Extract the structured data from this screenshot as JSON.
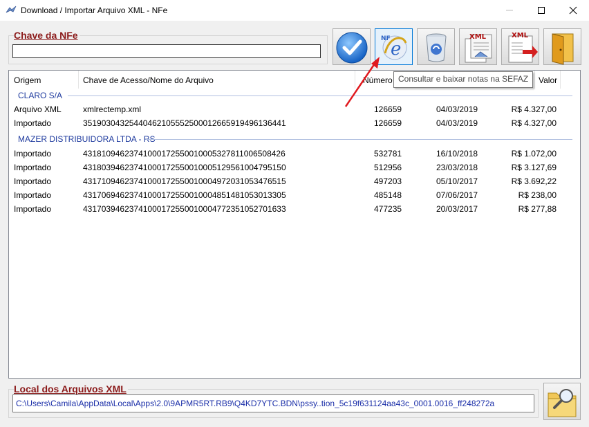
{
  "window": {
    "title": "Download / Importar Arquivo XML - NFe",
    "minimize": "—",
    "maximize": "☐",
    "close": "✕"
  },
  "chave_group": {
    "label": "Chave da NFe",
    "value": ""
  },
  "toolbar": {
    "buttons": [
      {
        "name": "confirm-button",
        "icon": "check-icon"
      },
      {
        "name": "sefaz-button",
        "icon": "nfe-e-icon"
      },
      {
        "name": "delete-button",
        "icon": "recycle-bin-icon"
      },
      {
        "name": "xml-list-button",
        "icon": "xml-document-icon"
      },
      {
        "name": "xml-import-button",
        "icon": "xml-arrow-icon"
      },
      {
        "name": "exit-button",
        "icon": "door-exit-icon"
      }
    ]
  },
  "tooltip": {
    "text": "Consultar e baixar notas na SEFAZ"
  },
  "list": {
    "columns": [
      "Origem",
      "Chave de Acesso/Nome do Arquivo",
      "Número",
      "Valor"
    ],
    "groups": [
      {
        "name": "CLARO S/A",
        "rows": [
          {
            "origem": "Arquivo XML",
            "chave": "xmlrectemp.xml",
            "numero": "126659",
            "data": "04/03/2019",
            "valor": "R$ 4.327,00"
          },
          {
            "origem": "Importado",
            "chave": "35190304325440462105552500012665919496136441",
            "numero": "126659",
            "data": "04/03/2019",
            "valor": "R$ 4.327,00"
          }
        ]
      },
      {
        "name": "MAZER DISTRIBUIDORA LTDA - RS",
        "rows": [
          {
            "origem": "Importado",
            "chave": "43181094623741000172550010005327811006508426",
            "numero": "532781",
            "data": "16/10/2018",
            "valor": "R$ 1.072,00"
          },
          {
            "origem": "Importado",
            "chave": "43180394623741000172550010005129561004795150",
            "numero": "512956",
            "data": "23/03/2018",
            "valor": "R$ 3.127,69"
          },
          {
            "origem": "Importado",
            "chave": "43171094623741000172550010004972031053476515",
            "numero": "497203",
            "data": "05/10/2017",
            "valor": "R$ 3.692,22"
          },
          {
            "origem": "Importado",
            "chave": "43170694623741000172550010004851481053013305",
            "numero": "485148",
            "data": "07/06/2017",
            "valor": "R$ 238,00"
          },
          {
            "origem": "Importado",
            "chave": "43170394623741000172550010004772351052701633",
            "numero": "477235",
            "data": "20/03/2017",
            "valor": "R$ 277,88"
          }
        ]
      }
    ]
  },
  "local_group": {
    "label": "Local dos Arquivos XML",
    "path": "C:\\Users\\Camila\\AppData\\Local\\Apps\\2.0\\9APMR5RT.RB9\\Q4KD7YTC.BDN\\pssy..tion_5c19f631124aa43c_0001.0016_ff248272a"
  },
  "colors": {
    "group_label": "#8b1a1a",
    "group_name": "#1e3a9e",
    "path_text": "#1a2ea8",
    "arrow": "#e0191e"
  }
}
